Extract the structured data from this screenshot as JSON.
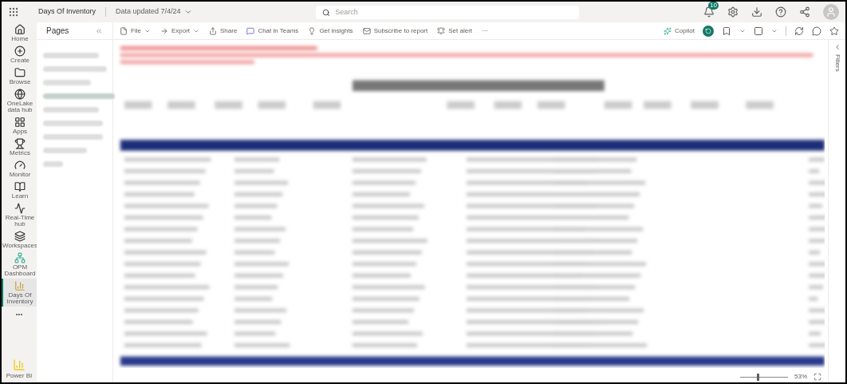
{
  "app_bar": {
    "report_name": "Days Of Inventory",
    "data_updated": "Data updated 7/4/24",
    "search": {
      "placeholder": "Search"
    },
    "notification_count": "10"
  },
  "nav": [
    {
      "label": "Home",
      "selected": false
    },
    {
      "label": "Create",
      "selected": false
    },
    {
      "label": "Browse",
      "selected": false
    },
    {
      "label": "OneLake data hub",
      "selected": false
    },
    {
      "label": "Apps",
      "selected": false
    },
    {
      "label": "Metrics",
      "selected": false
    },
    {
      "label": "Monitor",
      "selected": false
    },
    {
      "label": "Learn",
      "selected": false
    },
    {
      "label": "Real-Time hub",
      "selected": false
    },
    {
      "label": "Workspaces",
      "selected": false
    },
    {
      "label": "OPM Dashboard",
      "selected": false
    },
    {
      "label": "Days Of Inventory",
      "selected": true
    }
  ],
  "nav_more": "•••",
  "product": "Power BI",
  "pages_pane": {
    "title": "Pages"
  },
  "toolbar": {
    "left": [
      {
        "label": "File",
        "dropdown": true
      },
      {
        "label": "Export",
        "dropdown": true
      },
      {
        "label": "Share",
        "dropdown": false
      },
      {
        "label": "Chat in Teams",
        "dropdown": false
      },
      {
        "label": "Get insights",
        "dropdown": false
      },
      {
        "label": "Subscribe to report",
        "dropdown": false
      },
      {
        "label": "Set alert",
        "dropdown": false
      }
    ],
    "more": "···",
    "copilot": "Copilot"
  },
  "filters_pane": {
    "title": "Filters"
  },
  "zoom": {
    "level": 0.35,
    "reading": "53%"
  }
}
